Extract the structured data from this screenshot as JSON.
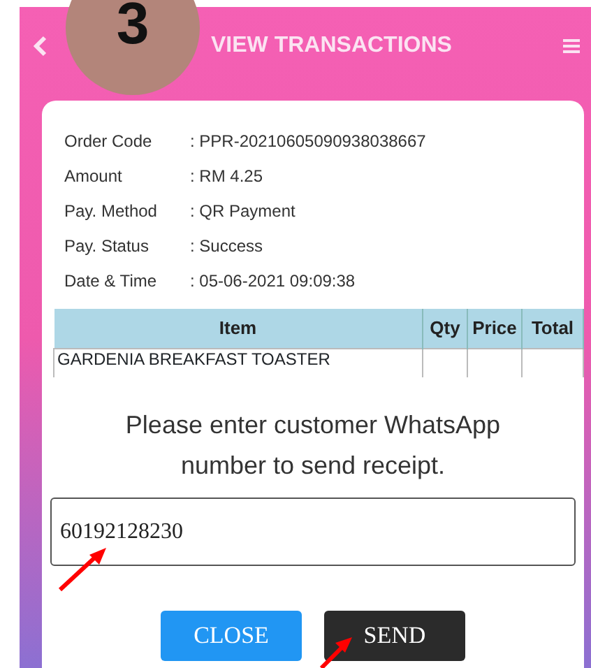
{
  "step_badge": "3",
  "header": {
    "title": "VIEW TRANSACTIONS"
  },
  "details": [
    {
      "label": "Order Code",
      "value": ": PPR-20210605090938038667"
    },
    {
      "label": "Amount",
      "value": ": RM 4.25"
    },
    {
      "label": "Pay. Method",
      "value": ": QR Payment"
    },
    {
      "label": "Pay. Status",
      "value": ": Success"
    },
    {
      "label": "Date & Time",
      "value": ": 05-06-2021 09:09:38"
    }
  ],
  "table": {
    "columns": [
      "Item",
      "Qty",
      "Price",
      "Total"
    ],
    "rows": [
      {
        "item": "GARDENIA BREAKFAST TOASTER"
      }
    ]
  },
  "dialog": {
    "message": "Please enter customer WhatsApp number to send receipt.",
    "value": "60192128230",
    "buttons": [
      {
        "label": "CLOSE",
        "kind": "close"
      },
      {
        "label": "SEND",
        "kind": "send"
      }
    ]
  }
}
